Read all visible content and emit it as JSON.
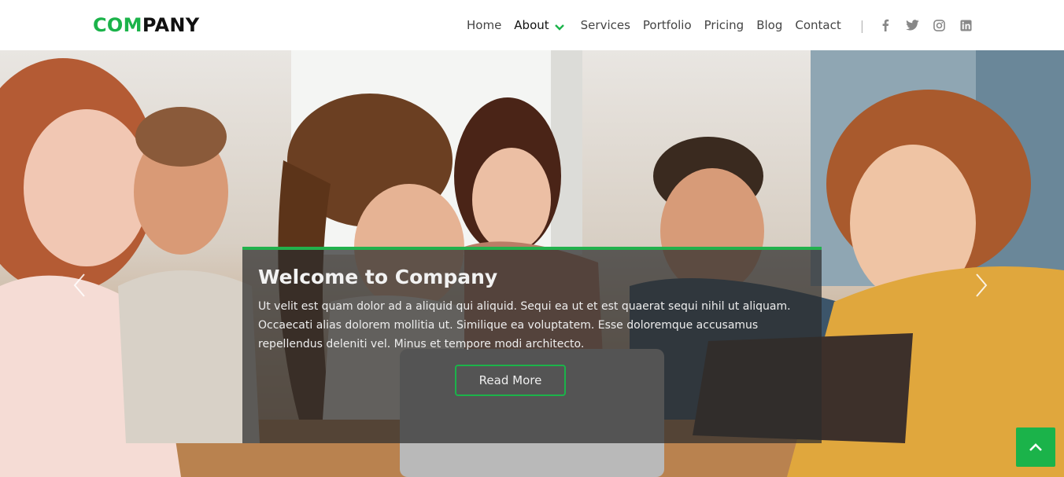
{
  "brand": {
    "logo_accent": "COM",
    "logo_rest": "PANY",
    "accent_color": "#1bb34a"
  },
  "nav": {
    "items": [
      {
        "label": "Home"
      },
      {
        "label": "About"
      },
      {
        "label": "Services"
      },
      {
        "label": "Portfolio"
      },
      {
        "label": "Pricing"
      },
      {
        "label": "Blog"
      },
      {
        "label": "Contact"
      }
    ],
    "separator": "|",
    "social": [
      "facebook-icon",
      "twitter-icon",
      "instagram-icon",
      "linkedin-icon"
    ]
  },
  "hero": {
    "title": "Welcome to Company",
    "text": "Ut velit est quam dolor ad a aliquid qui aliquid. Sequi ea ut et est quaerat sequi nihil ut aliquam. Occaecati alias dolorem mollitia ut. Similique ea voluptatem. Esse doloremque accusamus repellendus deleniti vel. Minus et tempore modi architecto.",
    "button_label": "Read More",
    "prev_icon": "chevron-left-icon",
    "next_icon": "chevron-right-icon"
  },
  "back_to_top_icon": "chevron-up-icon"
}
